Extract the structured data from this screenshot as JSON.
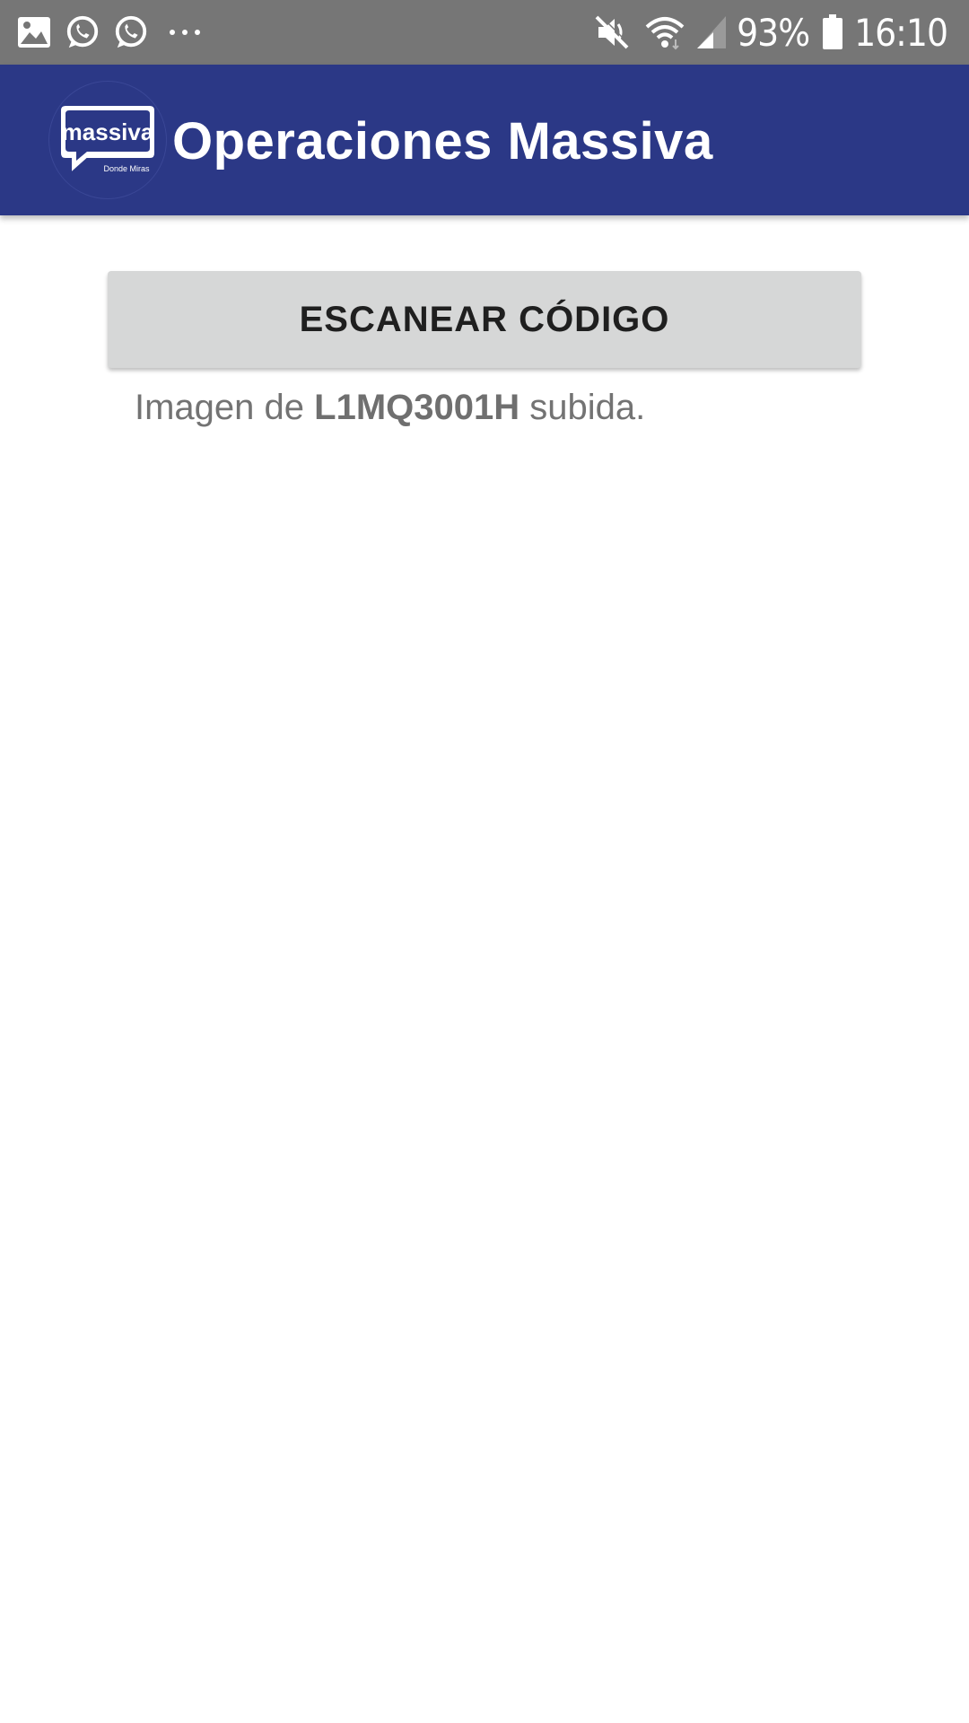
{
  "status_bar": {
    "left_icons": [
      "gallery-icon",
      "whatsapp-icon",
      "whatsapp-icon",
      "more-notifications-icon"
    ],
    "right_icons": [
      "mute-icon",
      "wifi-icon",
      "signal-icon",
      "battery-icon"
    ],
    "battery_percent": "93%",
    "time": "16:10",
    "background": "#767676"
  },
  "app_bar": {
    "logo": {
      "word": "massiva",
      "tagline": "Donde Miras"
    },
    "title": "Operaciones Massiva",
    "background": "#2b3886"
  },
  "main": {
    "scan_button_label": "ESCANEAR CÓDIGO",
    "message": {
      "prefix": "Imagen de ",
      "code": "L1MQ3001H",
      "suffix": " subida."
    }
  }
}
